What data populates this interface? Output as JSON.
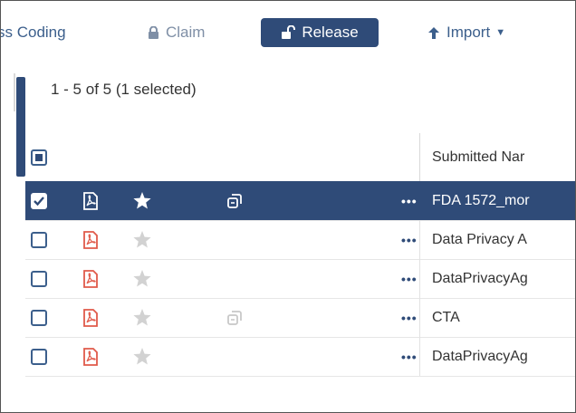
{
  "toolbar": {
    "coding_label": "ss Coding",
    "claim_label": "Claim",
    "release_label": "Release",
    "import_label": "Import"
  },
  "pager": {
    "text": "1 - 5 of 5 (1 selected)"
  },
  "table": {
    "column_name_header": "Submitted Nar",
    "rows": [
      {
        "name": "FDA 1572_mor",
        "selected": true,
        "starred": true,
        "duplicate_icon": true
      },
      {
        "name": "Data Privacy A",
        "selected": false,
        "starred": false,
        "duplicate_icon": false
      },
      {
        "name": "DataPrivacyAg",
        "selected": false,
        "starred": false,
        "duplicate_icon": false
      },
      {
        "name": "CTA",
        "selected": false,
        "starred": false,
        "duplicate_icon": true
      },
      {
        "name": "DataPrivacyAg",
        "selected": false,
        "starred": false,
        "duplicate_icon": false
      }
    ]
  },
  "colors": {
    "primary": "#2f4b78",
    "pdf_red": "#e05a4a",
    "star_gray": "#d2d2d2"
  },
  "icons": {
    "claim": "lock-icon",
    "release": "unlock-icon",
    "import": "arrow-up-icon",
    "pdf": "pdf-file-icon",
    "star": "star-icon",
    "duplicate": "duplicate-icon",
    "more": "ellipsis-icon"
  }
}
